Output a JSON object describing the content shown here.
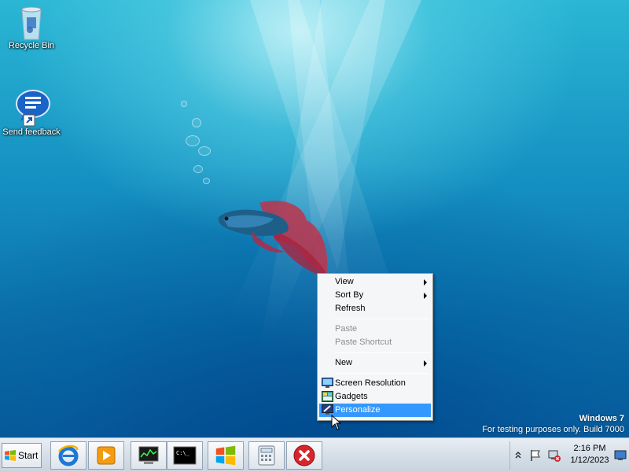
{
  "desktop": {
    "icons": [
      {
        "label": "Recycle Bin",
        "icon": "recycle-bin-icon"
      },
      {
        "label": "Send feedback",
        "icon": "feedback-speech-bubble-icon"
      }
    ],
    "watermark": {
      "title": "Windows  7",
      "subtitle": "For testing purposes only. Build 7000"
    }
  },
  "context_menu": {
    "items": [
      {
        "label": "View",
        "submenu": true,
        "enabled": true
      },
      {
        "label": "Sort By",
        "submenu": true,
        "enabled": true
      },
      {
        "label": "Refresh",
        "submenu": false,
        "enabled": true
      },
      {
        "label": "Paste",
        "submenu": false,
        "enabled": false
      },
      {
        "label": "Paste Shortcut",
        "submenu": false,
        "enabled": false
      },
      {
        "label": "New",
        "submenu": true,
        "enabled": true
      },
      {
        "label": "Screen Resolution",
        "icon": "monitor-icon",
        "enabled": true
      },
      {
        "label": "Gadgets",
        "icon": "gadgets-icon",
        "enabled": true
      },
      {
        "label": "Personalize",
        "icon": "personalize-icon",
        "enabled": true,
        "highlighted": true
      }
    ]
  },
  "taskbar": {
    "start_label": "Start",
    "pinned": [
      {
        "name": "internet-explorer-icon"
      },
      {
        "name": "media-player-icon"
      },
      {
        "name": "task-manager-icon"
      },
      {
        "name": "command-prompt-icon"
      },
      {
        "name": "windows-logo-icon"
      },
      {
        "name": "calculator-icon"
      },
      {
        "name": "stop-icon"
      }
    ],
    "clock": {
      "time": "2:16 PM",
      "date": "1/12/2023"
    }
  },
  "colors": {
    "menu_highlight": "#3399ff",
    "stop_red": "#d7262b"
  }
}
